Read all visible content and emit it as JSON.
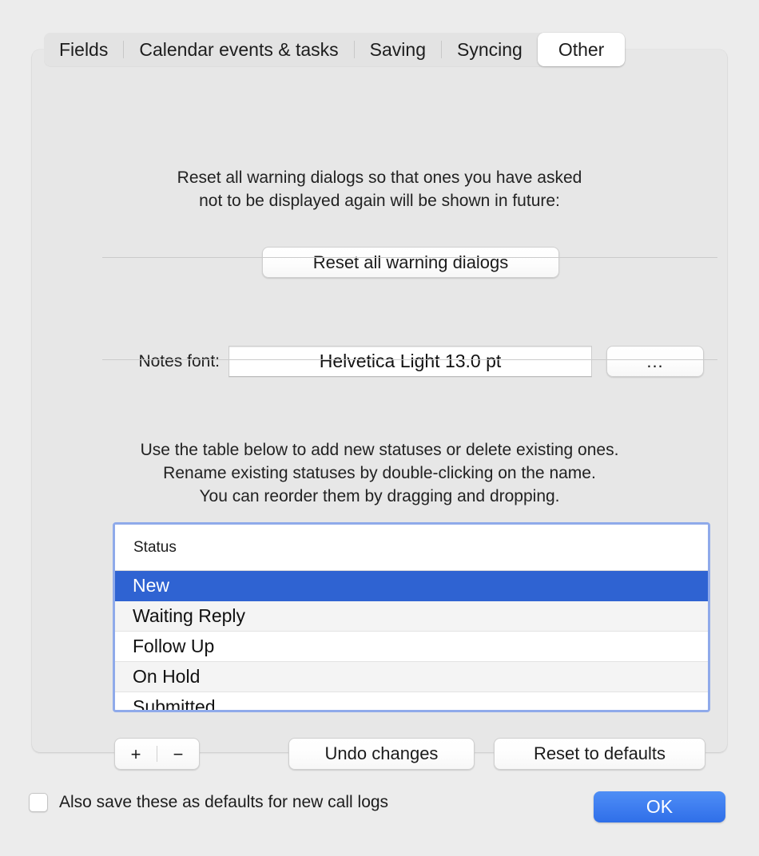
{
  "tabs": [
    {
      "label": "Fields",
      "selected": false
    },
    {
      "label": "Calendar events & tasks",
      "selected": false
    },
    {
      "label": "Saving",
      "selected": false
    },
    {
      "label": "Syncing",
      "selected": false
    },
    {
      "label": "Other",
      "selected": true
    }
  ],
  "reset_section": {
    "description_line1": "Reset all warning dialogs so that ones you have asked",
    "description_line2": "not to be displayed again will be shown in future:",
    "button_label": "Reset all warning dialogs"
  },
  "notes_font": {
    "label": "Notes font:",
    "value": "Helvetica Light 13.0 pt",
    "more_button_label": "..."
  },
  "statuses_section": {
    "description_line1": "Use the table below to add new statuses or delete existing ones.",
    "description_line2": "Rename existing statuses by double-clicking on the name.",
    "description_line3": "You can reorder them by dragging and dropping.",
    "table": {
      "columns": [
        "Status"
      ],
      "rows": [
        {
          "status": "New",
          "selected": true
        },
        {
          "status": "Waiting Reply",
          "selected": false
        },
        {
          "status": "Follow Up",
          "selected": false
        },
        {
          "status": "On Hold",
          "selected": false
        },
        {
          "status": "Submitted",
          "selected": false
        }
      ]
    },
    "add_button_label": "+",
    "remove_button_label": "−",
    "undo_button_label": "Undo changes",
    "reset_defaults_button_label": "Reset to defaults"
  },
  "footer": {
    "checkbox_label": "Also save these as defaults for new call logs",
    "checkbox_checked": false,
    "ok_button_label": "OK"
  },
  "colors": {
    "selection_blue": "#2f63d2",
    "focus_ring": "#8faaea",
    "ok_blue": "#3f7ef0",
    "panel_bg": "#e7e7e7",
    "window_bg": "#ececec"
  }
}
